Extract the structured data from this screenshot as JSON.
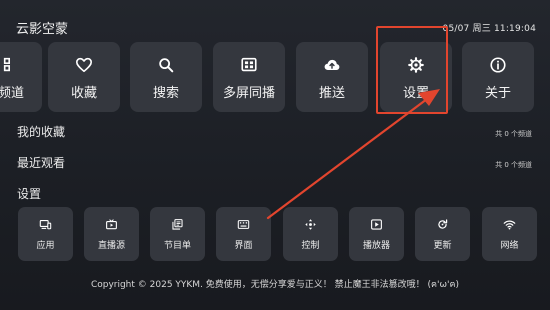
{
  "header": {
    "title": "云影空蒙",
    "datetime": "05/07 周三 11:19:04"
  },
  "main_tiles": [
    {
      "label": "频道",
      "icon": "grid-icon"
    },
    {
      "label": "收藏",
      "icon": "heart-icon"
    },
    {
      "label": "搜索",
      "icon": "search-icon"
    },
    {
      "label": "多屏同播",
      "icon": "multi-screen-icon"
    },
    {
      "label": "推送",
      "icon": "cloud-upload-icon"
    },
    {
      "label": "设置",
      "icon": "gear-icon"
    },
    {
      "label": "关于",
      "icon": "info-icon"
    }
  ],
  "sections": {
    "favorites": {
      "label": "我的收藏",
      "count": "共 0 个频道"
    },
    "recent": {
      "label": "最近观看",
      "count": "共 0 个频道"
    },
    "settings": {
      "label": "设置"
    }
  },
  "settings_tiles": [
    {
      "label": "应用",
      "icon": "devices-icon"
    },
    {
      "label": "直播源",
      "icon": "tv-icon"
    },
    {
      "label": "节目单",
      "icon": "playlist-icon"
    },
    {
      "label": "界面",
      "icon": "keyboard-icon"
    },
    {
      "label": "控制",
      "icon": "dpad-icon"
    },
    {
      "label": "播放器",
      "icon": "play-icon"
    },
    {
      "label": "更新",
      "icon": "refresh-icon"
    },
    {
      "label": "网络",
      "icon": "wifi-icon"
    }
  ],
  "footer": {
    "text": "Copyright © 2025 YYKM. 免费使用，无偿分享爱与正义！ 禁止魔王非法篡改哦！ (ฅ'ω'ฅ)"
  },
  "colors": {
    "highlight": "#e2452e",
    "tile_bg": "#34373e",
    "background": "#1e2127"
  }
}
